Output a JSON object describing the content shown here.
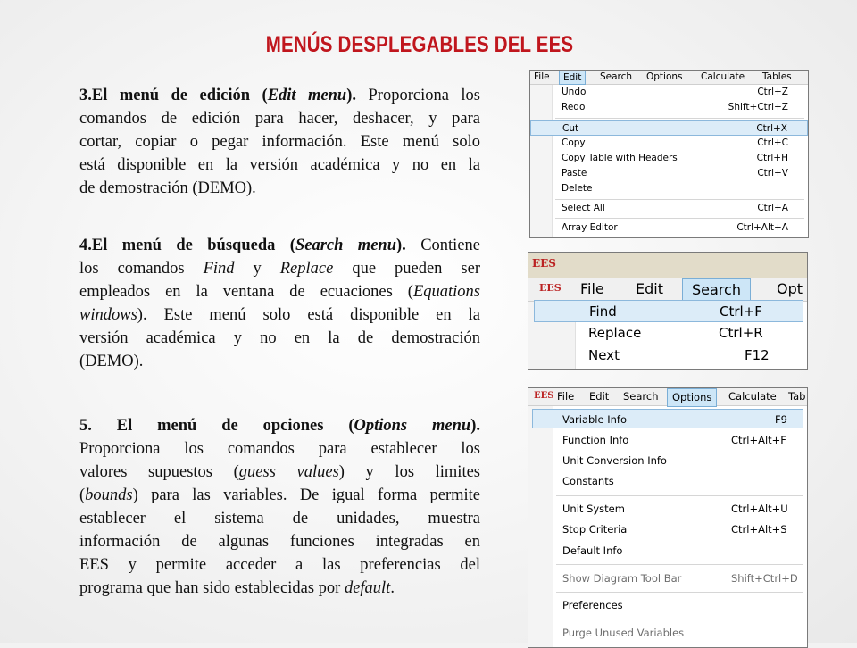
{
  "title": "MENÚS DESPLEGABLES DEL EES",
  "paragraphs": {
    "p3": {
      "lines": [
        [
          {
            "t": "3.El menú de edición (",
            "b": true
          },
          {
            "t": "Edit menu",
            "b": true,
            "i": true
          },
          {
            "t": "). ",
            "b": true
          },
          {
            "t": "Proporciona los"
          }
        ],
        [
          {
            "t": "comandos de edición para hacer, deshacer, y para"
          }
        ],
        [
          {
            "t": "cortar, copiar o pegar información. Este menú solo"
          }
        ],
        [
          {
            "t": "está disponible en la versión académica y no en la"
          }
        ],
        [
          {
            "t": "de demostración (DEMO)."
          }
        ]
      ]
    },
    "p4": {
      "lines": [
        [
          {
            "t": "4.El menú de búsqueda (",
            "b": true
          },
          {
            "t": "Search menu",
            "b": true,
            "i": true
          },
          {
            "t": "). ",
            "b": true
          },
          {
            "t": "Contiene"
          }
        ],
        [
          {
            "t": "los comandos "
          },
          {
            "t": "Find",
            "i": true
          },
          {
            "t": " y "
          },
          {
            "t": "Replace",
            "i": true
          },
          {
            "t": " que pueden ser"
          }
        ],
        [
          {
            "t": "empleados en la ventana de ecuaciones ("
          },
          {
            "t": "Equations",
            "i": true
          },
          {
            "t": ""
          }
        ],
        [
          {
            "t": "windows",
            "i": true
          },
          {
            "t": "). Este menú solo está disponible en la"
          }
        ],
        [
          {
            "t": "versión académica y no en la de demostración"
          }
        ],
        [
          {
            "t": "(DEMO)."
          }
        ]
      ]
    },
    "p5": {
      "lines": [
        [
          {
            "t": "5. El menú de opciones (",
            "b": true
          },
          {
            "t": "Options menu",
            "b": true,
            "i": true
          },
          {
            "t": ").",
            "b": true
          }
        ],
        [
          {
            "t": "Proporciona los comandos para establecer los"
          }
        ],
        [
          {
            "t": "valores supuestos ("
          },
          {
            "t": "guess values",
            "i": true
          },
          {
            "t": ") y los limites"
          }
        ],
        [
          {
            "t": "("
          },
          {
            "t": "bounds",
            "i": true
          },
          {
            "t": ") para las variables. De igual forma permite"
          }
        ],
        [
          {
            "t": "establecer el sistema de unidades, muestra"
          }
        ],
        [
          {
            "t": "información de algunas funciones integradas en"
          }
        ],
        [
          {
            "t": "EES y permite acceder a las preferencias del"
          }
        ],
        [
          {
            "t": "programa que han sido establecidas por "
          },
          {
            "t": "default",
            "i": true
          },
          {
            "t": "."
          }
        ]
      ]
    }
  },
  "edit_menu": {
    "menubar": [
      "File",
      "Edit",
      "Search",
      "Options",
      "Calculate",
      "Tables"
    ],
    "items": [
      {
        "label": "Undo",
        "shortcut": "Ctrl+Z"
      },
      {
        "label": "Redo",
        "shortcut": "Shift+Ctrl+Z"
      },
      {
        "label": "Cut",
        "shortcut": "Ctrl+X"
      },
      {
        "label": "Copy",
        "shortcut": "Ctrl+C"
      },
      {
        "label": "Copy Table with Headers",
        "shortcut": "Ctrl+H"
      },
      {
        "label": "Paste",
        "shortcut": "Ctrl+V"
      },
      {
        "label": "Delete",
        "shortcut": ""
      },
      {
        "label": "Select All",
        "shortcut": "Ctrl+A"
      },
      {
        "label": "Array Editor",
        "shortcut": "Ctrl+Alt+A"
      }
    ]
  },
  "search_menu": {
    "logo": "EES",
    "menubar": [
      "File",
      "Edit",
      "Search",
      "Opt"
    ],
    "items": [
      {
        "label": "Find",
        "shortcut": "Ctrl+F"
      },
      {
        "label": "Replace",
        "shortcut": "Ctrl+R"
      },
      {
        "label": "Next",
        "shortcut": "F12"
      }
    ]
  },
  "options_menu": {
    "menubar": [
      "File",
      "Edit",
      "Search",
      "Options",
      "Calculate",
      "Tab"
    ],
    "items": [
      {
        "label": "Variable Info",
        "shortcut": "F9"
      },
      {
        "label": "Function Info",
        "shortcut": "Ctrl+Alt+F"
      },
      {
        "label": "Unit Conversion Info",
        "shortcut": ""
      },
      {
        "label": "Constants",
        "shortcut": ""
      },
      {
        "label": "Unit System",
        "shortcut": "Ctrl+Alt+U"
      },
      {
        "label": "Stop Criteria",
        "shortcut": "Ctrl+Alt+S"
      },
      {
        "label": "Default Info",
        "shortcut": ""
      },
      {
        "label": "Show Diagram Tool Bar",
        "shortcut": "Shift+Ctrl+D"
      },
      {
        "label": "Preferences",
        "shortcut": ""
      },
      {
        "label": "Purge Unused Variables",
        "shortcut": ""
      }
    ]
  },
  "colors": {
    "title": "#c0161d",
    "highlight": "#dcecf8",
    "logo": "#b22222"
  }
}
